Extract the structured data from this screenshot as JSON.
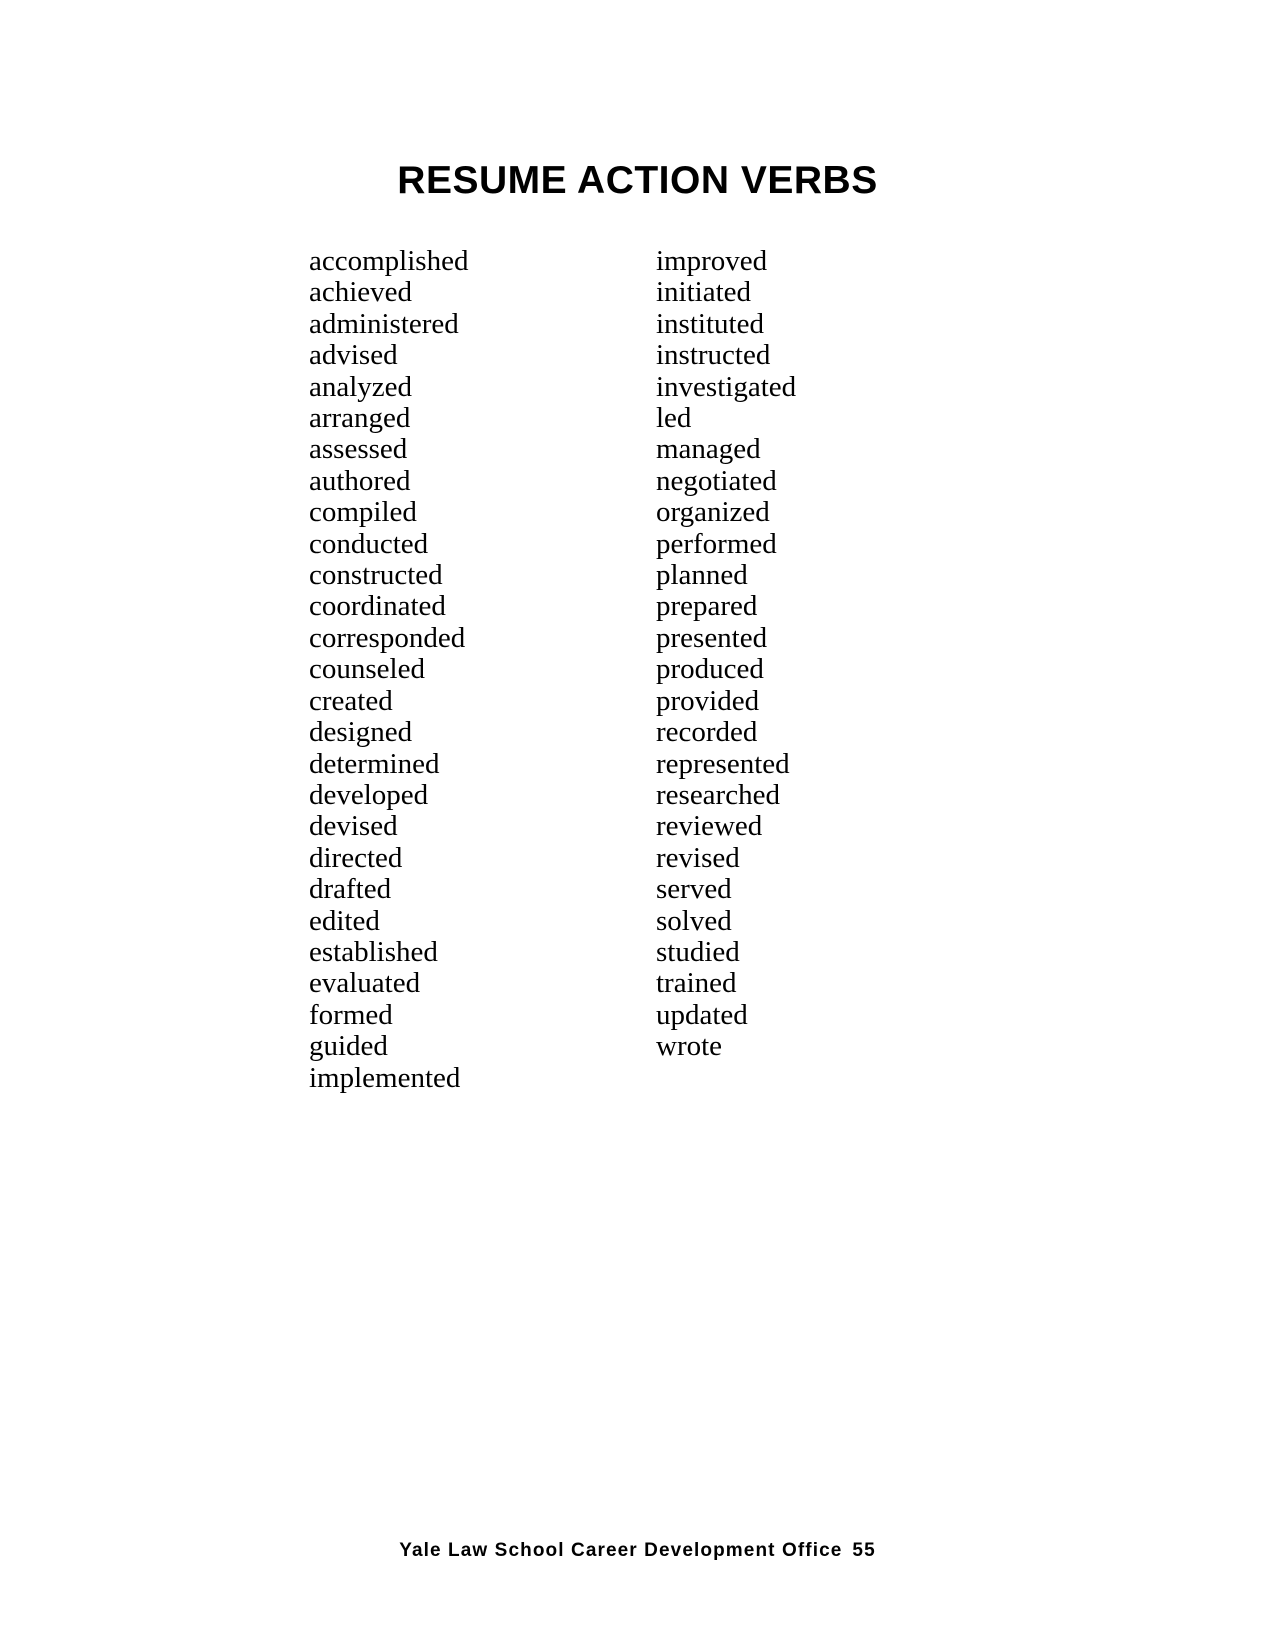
{
  "document": {
    "title": "RESUME ACTION VERBS",
    "background_color": "#ffffff",
    "text_color": "#000000"
  },
  "columns": [
    {
      "name": "verbs-column-left",
      "items": [
        "accomplished",
        "achieved",
        "administered",
        "advised",
        "analyzed",
        "arranged",
        "assessed",
        "authored",
        "compiled",
        "conducted",
        "constructed",
        "coordinated",
        "corresponded",
        "counseled",
        "created",
        "designed",
        "determined",
        "developed",
        "devised",
        "directed",
        "drafted",
        "edited",
        "established",
        "evaluated",
        "formed",
        "guided",
        "implemented"
      ]
    },
    {
      "name": "verbs-column-right",
      "items": [
        "improved",
        "initiated",
        "instituted",
        "instructed",
        "investigated",
        "led",
        "managed",
        "negotiated",
        "organized",
        "performed",
        "planned",
        "prepared",
        "presented",
        "produced",
        "provided",
        "recorded",
        "represented",
        "researched",
        "reviewed",
        "revised",
        "served",
        "solved",
        "studied",
        "trained",
        "updated",
        "wrote"
      ]
    }
  ],
  "footer": {
    "organization": "Yale Law School Career Development Office",
    "page_number": "55"
  }
}
